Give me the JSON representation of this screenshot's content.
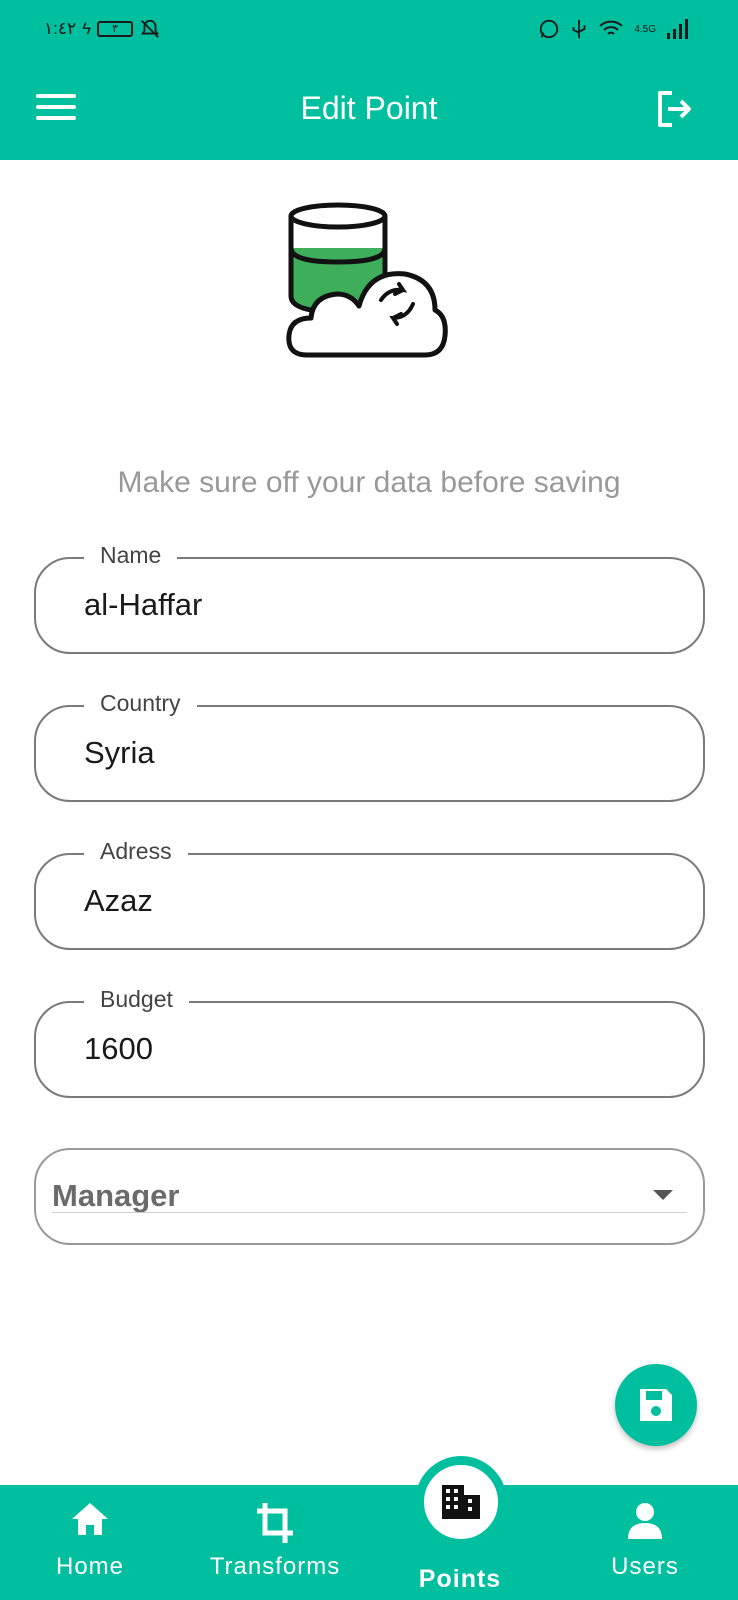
{
  "status_bar": {
    "time": "١:٤٢",
    "battery": "٣",
    "network": "4.5G"
  },
  "header": {
    "title": "Edit Point"
  },
  "form": {
    "hint": "Make sure off your data before saving",
    "name": {
      "label": "Name",
      "value": "al-Haffar"
    },
    "country": {
      "label": "Country",
      "value": "Syria"
    },
    "address": {
      "label": "Adress",
      "value": "Azaz"
    },
    "budget": {
      "label": "Budget",
      "value": "1600"
    },
    "manager": {
      "placeholder": "Manager"
    }
  },
  "bottom_nav": {
    "items": [
      {
        "label": "Home",
        "icon": "home-icon"
      },
      {
        "label": "Transforms",
        "icon": "crop-icon"
      },
      {
        "label": "Points",
        "icon": "building-icon",
        "active": true
      },
      {
        "label": "Users",
        "icon": "person-icon"
      }
    ]
  },
  "colors": {
    "accent": "#00bf9f",
    "illustration_green": "#3fae5a"
  }
}
